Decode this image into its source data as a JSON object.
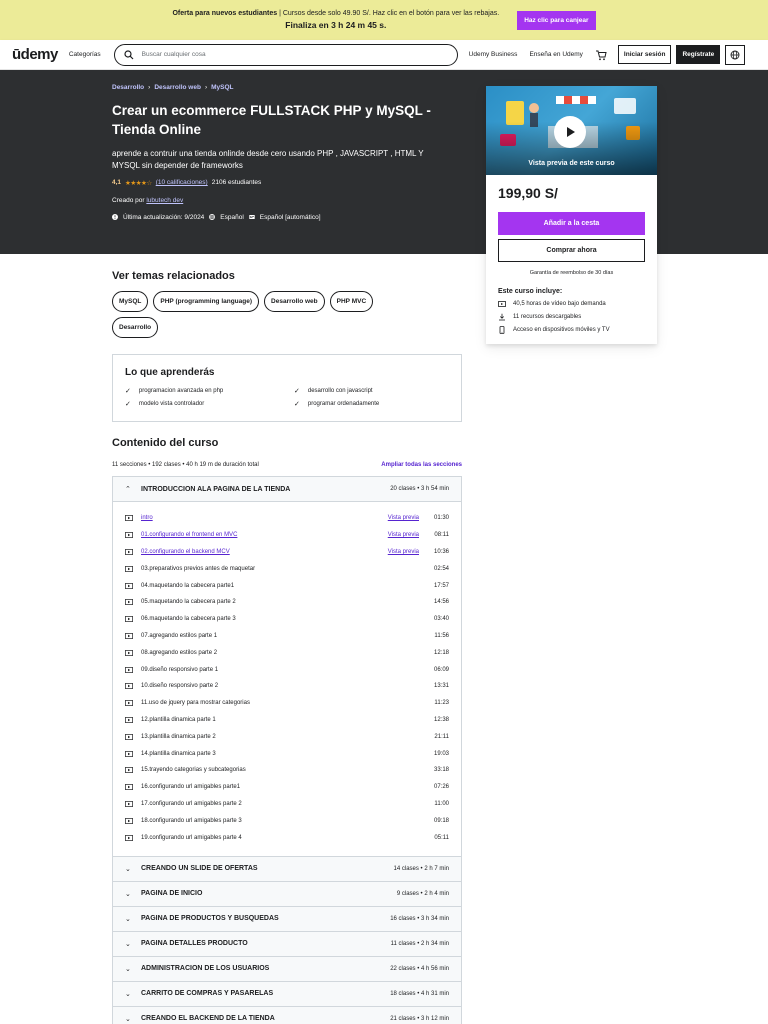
{
  "promo": {
    "bold": "Oferta para nuevos estudiantes",
    "text": " | Cursos desde solo 49.90 S/. Haz clic en el botón para ver las rebajas.",
    "countdown": "Finaliza en 3 h 24 m 45 s.",
    "button": "Haz clic para canjear"
  },
  "header": {
    "logo": "ūdemy",
    "categories": "Categorías",
    "search_placeholder": "Buscar cualquier cosa",
    "business": "Udemy Business",
    "teach": "Enseña en Udemy",
    "login": "Iniciar sesión",
    "signup": "Regístrate"
  },
  "hero": {
    "breadcrumb": [
      "Desarrollo",
      "Desarrollo web",
      "MySQL"
    ],
    "title": "Crear un ecommerce FULLSTACK PHP y MySQL - Tienda Online",
    "subtitle": "aprende a contruir una tienda onlinde desde cero usando PHP , JAVASCRIPT , HTML Y MYSQL sin depender de frameworks",
    "rating": "4,1",
    "stars": "★★★★☆",
    "ratings_link": "(10 calificaciones)",
    "students": "2106 estudiantes",
    "created_by": "Creado por",
    "author": "lubutech dev",
    "updated": "Última actualización: 9/2024",
    "language": "Español",
    "captions": "Español [automático]"
  },
  "card": {
    "preview_label": "Vista previa de este curso",
    "price": "199,90 S/",
    "add_to_cart": "Añadir a la cesta",
    "buy_now": "Comprar ahora",
    "guarantee": "Garantía de reembolso de 30 días",
    "includes_title": "Este curso incluye:",
    "includes": [
      {
        "icon": "video-icon",
        "text": "40,5 horas de vídeo bajo demanda"
      },
      {
        "icon": "download-icon",
        "text": "11 recursos descargables"
      },
      {
        "icon": "mobile-icon",
        "text": "Acceso en dispositivos móviles y TV"
      }
    ]
  },
  "topics": {
    "title": "Ver temas relacionados",
    "items": [
      "MySQL",
      "PHP (programming language)",
      "Desarrollo web",
      "PHP MVC",
      "Desarrollo"
    ]
  },
  "learn": {
    "title": "Lo que aprenderás",
    "items": [
      "programacion avanzada en php",
      "desarrollo con javascript",
      "modelo vista controlador",
      "programar ordenadamente"
    ]
  },
  "content": {
    "title": "Contenido del curso",
    "summary": "11 secciones • 192 clases • 40 h 19 m de duración total",
    "expand_all": "Ampliar todas las secciones",
    "open_section": {
      "name": "INTRODUCCION ALA PAGINA DE LA TIENDA",
      "info": "20 clases • 3 h 54 min"
    },
    "lectures": [
      {
        "title": "intro",
        "preview": "Vista previa",
        "duration": "01:30",
        "link": true
      },
      {
        "title": "01.configurando el frontend en MVC",
        "preview": "Vista previa",
        "duration": "08:11",
        "link": true
      },
      {
        "title": "02.configurando el backend MCV",
        "preview": "Vista previa",
        "duration": "10:36",
        "link": true
      },
      {
        "title": "03.preparativos previos antes de maquetar",
        "preview": "",
        "duration": "02:54",
        "link": false
      },
      {
        "title": "04.maquetando la cabecera parte1",
        "preview": "",
        "duration": "17:57",
        "link": false
      },
      {
        "title": "05.maquetando la cabecera parte 2",
        "preview": "",
        "duration": "14:56",
        "link": false
      },
      {
        "title": "06.maquetando la cabecera parte 3",
        "preview": "",
        "duration": "03:40",
        "link": false
      },
      {
        "title": "07.agregando estilos parte 1",
        "preview": "",
        "duration": "11:56",
        "link": false
      },
      {
        "title": "08.agregando estilos parte 2",
        "preview": "",
        "duration": "12:18",
        "link": false
      },
      {
        "title": "09.diseño responsivo parte 1",
        "preview": "",
        "duration": "06:09",
        "link": false
      },
      {
        "title": "10.diseño responsivo parte 2",
        "preview": "",
        "duration": "13:31",
        "link": false
      },
      {
        "title": "11.uso de jquery para mostrar categorias",
        "preview": "",
        "duration": "11:23",
        "link": false
      },
      {
        "title": "12.plantilla dinamica parte 1",
        "preview": "",
        "duration": "12:38",
        "link": false
      },
      {
        "title": "13.plantilla dinamica parte 2",
        "preview": "",
        "duration": "21:11",
        "link": false
      },
      {
        "title": "14.plantilla dinamica parte 3",
        "preview": "",
        "duration": "19:03",
        "link": false
      },
      {
        "title": "15.trayendo categorias y subcategorias",
        "preview": "",
        "duration": "33:18",
        "link": false
      },
      {
        "title": "16.configurando url amigables parte1",
        "preview": "",
        "duration": "07:26",
        "link": false
      },
      {
        "title": "17.configurando url amigables parte 2",
        "preview": "",
        "duration": "11:00",
        "link": false
      },
      {
        "title": "18.configurando url amigables parte 3",
        "preview": "",
        "duration": "09:18",
        "link": false
      },
      {
        "title": "19.configurando url amigables parte 4",
        "preview": "",
        "duration": "05:11",
        "link": false
      }
    ],
    "sections": [
      {
        "name": "CREANDO UN SLIDE DE OFERTAS",
        "info": "14 clases • 2 h 7 min"
      },
      {
        "name": "PAGINA DE INICIO",
        "info": "9 clases • 2 h 4 min"
      },
      {
        "name": "PAGINA DE PRODUCTOS Y BUSQUEDAS",
        "info": "16 clases • 3 h 34 min"
      },
      {
        "name": "PAGINA DETALLES PRODUCTO",
        "info": "11 clases • 2 h 34 min"
      },
      {
        "name": "ADMINISTRACION DE LOS USUARIOS",
        "info": "22 clases • 4 h 56 min"
      },
      {
        "name": "CARRITO DE COMPRAS Y PASARELAS",
        "info": "18 clases • 4 h 31 min"
      },
      {
        "name": "CREANDO EL BACKEND DE LA TIENDA",
        "info": "21 clases • 3 h 12 min"
      }
    ]
  },
  "colors": {
    "brand": "#a435f0",
    "link": "#5624d0",
    "hero_bg": "#2d2f31",
    "banner_bg": "#eceb98",
    "star": "#e59819"
  }
}
